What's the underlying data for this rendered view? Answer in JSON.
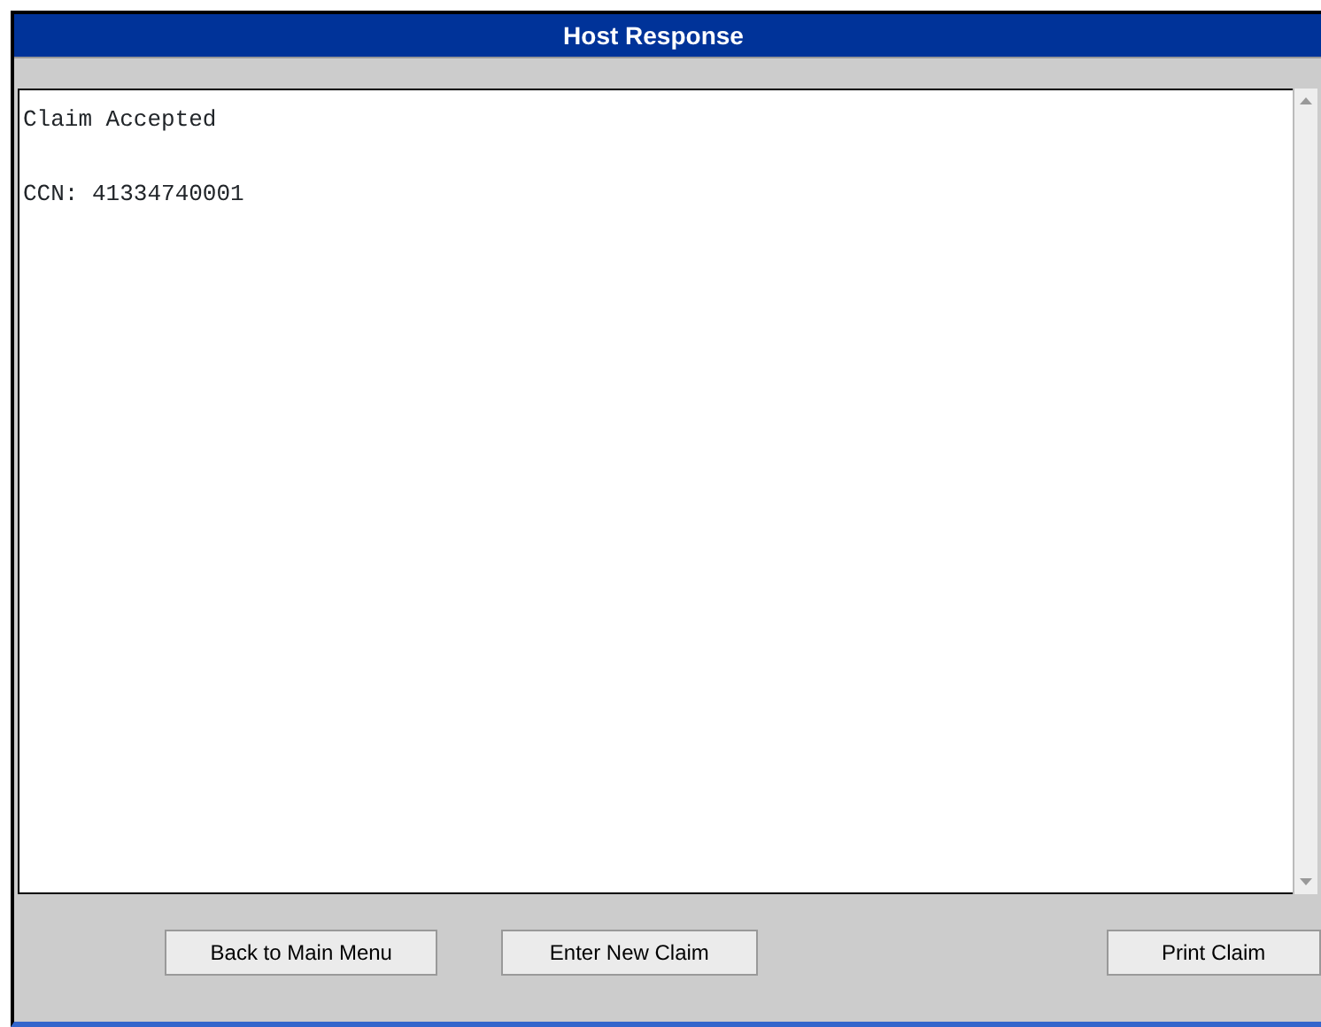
{
  "window": {
    "title": "Host Response"
  },
  "response": {
    "lines": [
      "Claim Accepted",
      "CCN: 41334740001"
    ]
  },
  "buttons": [
    {
      "label": "Back to Main Menu"
    },
    {
      "label": "Enter New Claim"
    },
    {
      "label": "Print Claim"
    }
  ]
}
